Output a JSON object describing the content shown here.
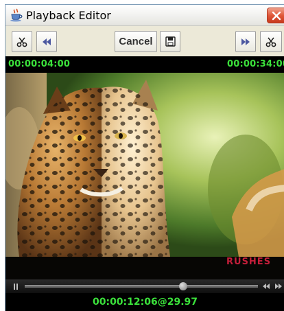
{
  "window": {
    "title": "Playback Editor",
    "icon": "java-cup-icon"
  },
  "toolbar": {
    "cancel_label": "Cancel",
    "buttons_left": [
      "cut-icon",
      "rewind-icon"
    ],
    "buttons_center": [
      "save-icon"
    ],
    "buttons_right": [
      "fast-forward-icon",
      "cut-icon"
    ]
  },
  "timecodes": {
    "start": "00:00:04:00",
    "end": "00:00:34:00"
  },
  "video": {
    "watermark": "RUSHES"
  },
  "playback": {
    "position_fraction": 0.68
  },
  "status": {
    "current": "00:00:12:06@29.97"
  },
  "colors": {
    "timecode_green": "#3be23b",
    "watermark_red": "#c41e3a",
    "close_red": "#e0583a"
  }
}
